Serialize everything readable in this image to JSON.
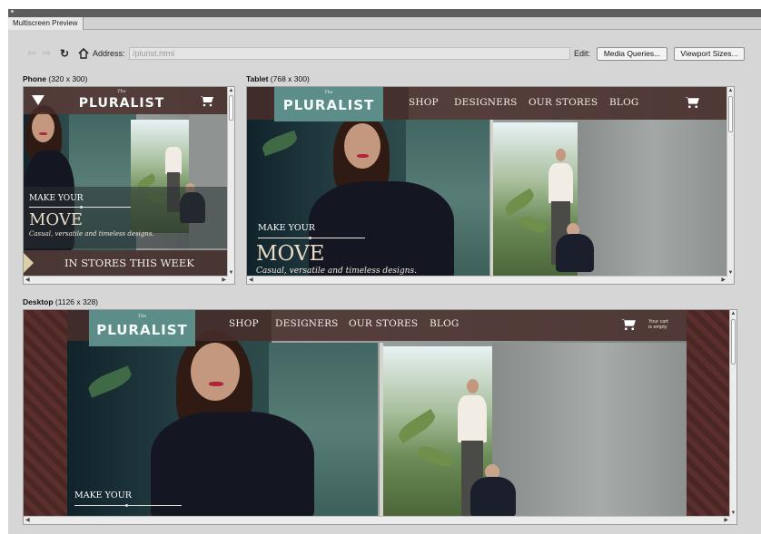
{
  "window": {
    "tab_title": "Multiscreen Preview"
  },
  "toolbar": {
    "back_icon": "back-arrow-icon",
    "forward_icon": "forward-arrow-icon",
    "refresh_icon": "refresh-icon",
    "home_icon": "home-icon",
    "address_label": "Address:",
    "address_value": "/plurist.html",
    "edit_label": "Edit:",
    "media_queries_label": "Media Queries...",
    "viewport_sizes_label": "Viewport Sizes..."
  },
  "viewports": {
    "phone": {
      "name": "Phone",
      "dims": "(320 x 300)"
    },
    "tablet": {
      "name": "Tablet",
      "dims": "(768 x 300)"
    },
    "desktop": {
      "name": "Desktop",
      "dims": "(1126 x 328)"
    }
  },
  "site": {
    "logo_the": "The",
    "logo": "PLURALIST",
    "nav": [
      "SHOP",
      "DESIGNERS",
      "OUR STORES",
      "BLOG"
    ],
    "cart_text_line1": "Your cart",
    "cart_text_line2": "is empty",
    "hero_make": "MAKE YOUR",
    "hero_move": "MOVE",
    "hero_sub": "Casual, versatile and timeless designs.",
    "banner": "IN STORES THIS WEEK"
  },
  "colors": {
    "panel_bg": "#d6d6d6",
    "logo_teal": "#5c8d89",
    "nav_brown": "#482d2a"
  }
}
